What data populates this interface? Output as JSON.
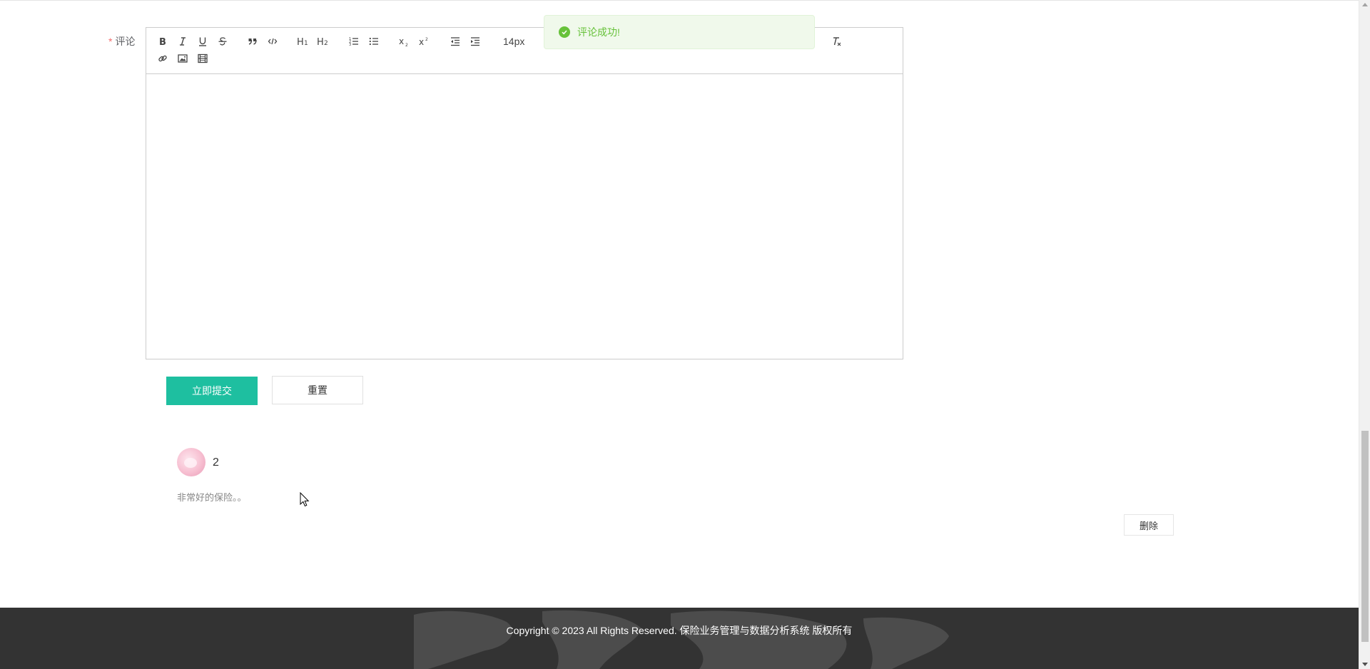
{
  "form": {
    "comment_label": "评论",
    "required_mark": "*"
  },
  "editor": {
    "font_size": "14px",
    "toolbar": [
      "bold-icon",
      "italic-icon",
      "underline-icon",
      "strike-icon",
      "blockquote-icon",
      "code-block-icon",
      "header-1-icon",
      "header-2-icon",
      "ordered-list-icon",
      "bullet-list-icon",
      "subscript-icon",
      "superscript-icon",
      "outdent-icon",
      "indent-icon",
      "clean-format-icon",
      "link-icon",
      "image-icon",
      "video-icon"
    ],
    "content": ""
  },
  "toast": {
    "message": "评论成功!",
    "type": "success",
    "color": "#67c23a"
  },
  "actions": {
    "submit_label": "立即提交",
    "reset_label": "重置",
    "accent_color": "#1ebfa0"
  },
  "comments": [
    {
      "user": "2",
      "content": "非常好的保险。。",
      "delete_label": "删除"
    }
  ],
  "footer": {
    "copyright": "Copyright © 2023 All Rights Reserved. 保险业务管理与数据分析系统 版权所有"
  }
}
